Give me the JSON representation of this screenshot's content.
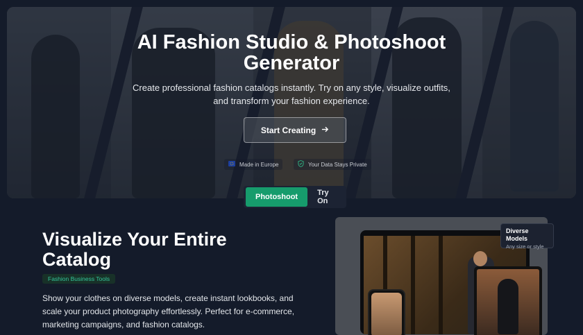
{
  "hero": {
    "title": "AI Fashion Studio & Photoshoot Generator",
    "subtitle": "Create professional fashion catalogs instantly. Try on any style, visualize outfits, and transform your fashion experience.",
    "cta_label": "Start Creating",
    "badges": [
      {
        "label": "Made in Europe",
        "icon": "eu-flag-icon"
      },
      {
        "label": "Your Data Stays Private",
        "icon": "shield-check-icon"
      }
    ]
  },
  "tabs": [
    {
      "label": "Photoshoot",
      "active": true
    },
    {
      "label": "Try On",
      "active": false
    }
  ],
  "section": {
    "title": "Visualize Your Entire Catalog",
    "tag": "Fashion Business Tools",
    "description": "Show your clothes on diverse models, create instant lookbooks, and scale your product photography effortlessly. Perfect for e-commerce, marketing campaigns, and fashion catalogs."
  },
  "preview": {
    "callout_title": "Diverse Models",
    "callout_subtitle": "Any size or style"
  },
  "colors": {
    "background": "#141b2a",
    "accent": "#169c6c",
    "tag_text": "#33c59a"
  }
}
